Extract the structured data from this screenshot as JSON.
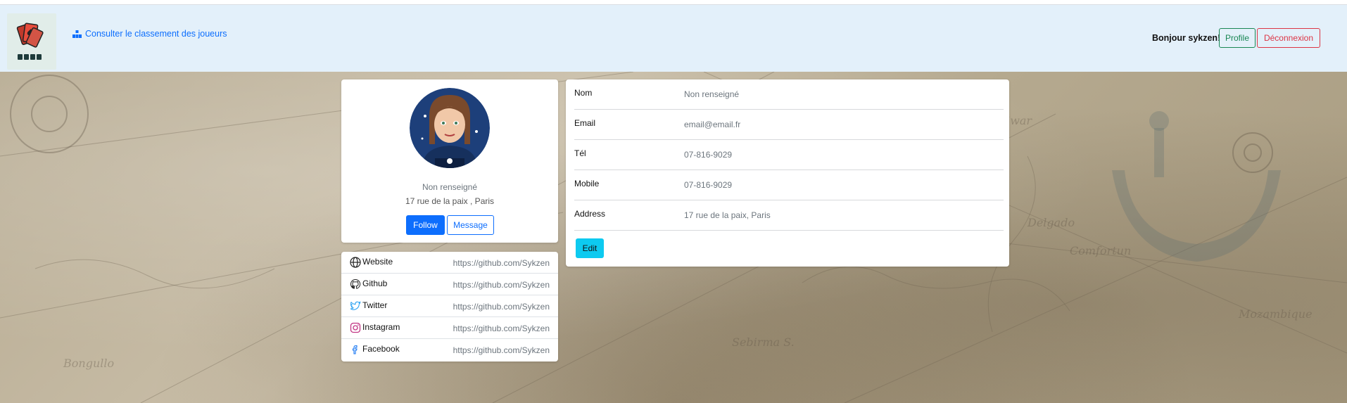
{
  "navbar": {
    "ranking_link": "Consulter le classement des joueurs",
    "greeting": "Bonjour sykzen!",
    "profile_button": "Profile",
    "logout_button": "Déconnexion"
  },
  "profile": {
    "name": "Non renseigné",
    "address": "17 rue de la paix , Paris",
    "follow_button": "Follow",
    "message_button": "Message"
  },
  "social_links": [
    {
      "label": "Website",
      "url": "https://github.com/Sykzen",
      "icon": "globe-icon"
    },
    {
      "label": "Github",
      "url": "https://github.com/Sykzen",
      "icon": "github-icon"
    },
    {
      "label": "Twitter",
      "url": "https://github.com/Sykzen",
      "icon": "twitter-icon"
    },
    {
      "label": "Instagram",
      "url": "https://github.com/Sykzen",
      "icon": "instagram-icon"
    },
    {
      "label": "Facebook",
      "url": "https://github.com/Sykzen",
      "icon": "facebook-icon"
    }
  ],
  "details": [
    {
      "label": "Nom",
      "value": "Non renseigné"
    },
    {
      "label": "Email",
      "value": "email@email.fr"
    },
    {
      "label": "Tél",
      "value": "07-816-9029"
    },
    {
      "label": "Mobile",
      "value": "07-816-9029"
    },
    {
      "label": "Address",
      "value": "17 rue de la paix, Paris"
    }
  ],
  "edit_button": "Edit",
  "colors": {
    "navbar_bg": "#e3f0fa",
    "primary": "#0d6efd",
    "success": "#198754",
    "danger": "#dc3545",
    "info": "#0dcaf0"
  }
}
